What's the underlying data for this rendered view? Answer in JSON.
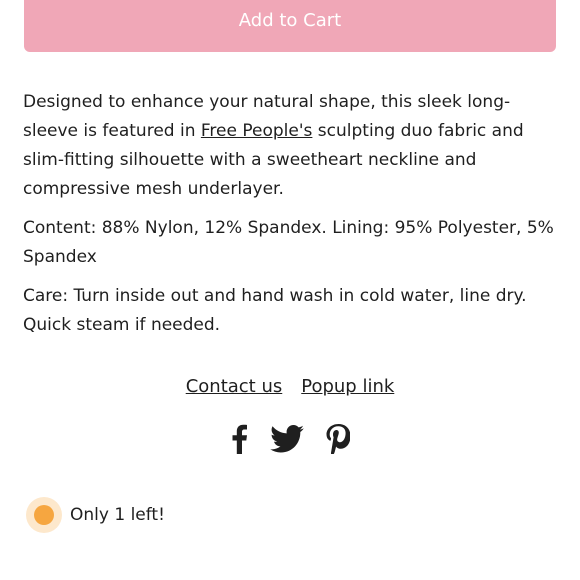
{
  "cart": {
    "button_label": "Add to Cart"
  },
  "description": {
    "p1_before": "Designed to enhance your natural shape, this sleek long-sleeve is featured in ",
    "p1_link": "Free People's",
    "p1_after": " sculpting duo fabric and slim-fitting silhouette with a sweetheart neckline and compressive mesh underlayer.",
    "content": "Content: 88% Nylon, 12% Spandex. Lining: 95% Polyester, 5% Spandex",
    "care": "Care: Turn inside out and hand wash in cold water, line dry. Quick steam if needed."
  },
  "links": {
    "contact": "Contact us",
    "popup": "Popup link"
  },
  "social": {
    "icons": [
      "facebook-icon",
      "twitter-icon",
      "pinterest-icon"
    ]
  },
  "stock": {
    "text": "Only 1 left!",
    "dot_color": "#f6a640"
  },
  "colors": {
    "button_bg": "#f0a7b7",
    "text": "#1f1f1f"
  }
}
